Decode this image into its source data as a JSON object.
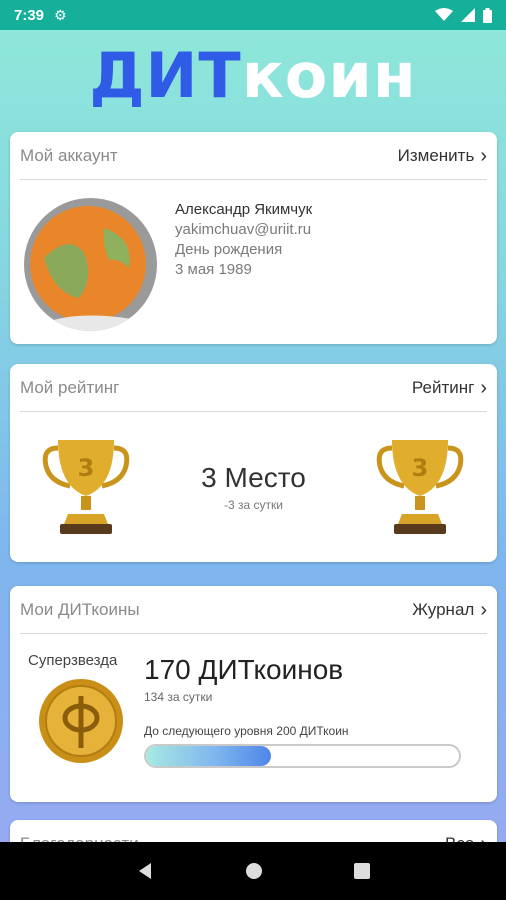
{
  "status_bar": {
    "time": "7:39",
    "icons": [
      "gear-icon",
      "wifi-icon",
      "signal-icon",
      "battery-icon"
    ]
  },
  "logo": {
    "part1": "ДИТ",
    "part2": "коин"
  },
  "account": {
    "title": "Мой аккаунт",
    "link": "Изменить",
    "name": "Александр Якимчук",
    "email": "yakimchuav@uriit.ru",
    "birthday_label": "День рождения",
    "birthday": "3 мая 1989"
  },
  "rating": {
    "title": "Мой рейтинг",
    "link": "Рейтинг",
    "place": "3 Место",
    "delta": "-3 за сутки",
    "trophy_digit": "3"
  },
  "coins": {
    "title": "Мои ДИТкоины",
    "link": "Журнал",
    "level": "Суперзвезда",
    "amount": "170 ДИТкоинов",
    "per_day": "134 за сутки",
    "next_level": "До следующего уровня 200 ДИТкоин",
    "progress_fraction": 0.4
  },
  "thanks": {
    "title": "Благодарности",
    "link": "Все"
  },
  "nav": {
    "icons": [
      "back-icon",
      "home-icon",
      "recents-icon"
    ]
  },
  "colors": {
    "accent": "#2f5be6",
    "status_bar": "#16b09a",
    "gold": "#d9a520"
  }
}
